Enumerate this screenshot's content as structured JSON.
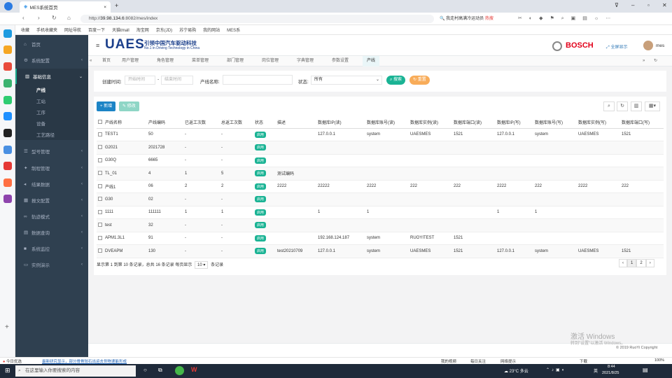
{
  "browser": {
    "tab_title": "MES系统首页",
    "url_prefix": "http://",
    "url_host": "39.98.134.6",
    "url_rest": ":8082/mes/index",
    "search_hint": "我走村高满冷运动员",
    "hot_label": "热搜",
    "bookmarks": [
      "收藏",
      "手机收藏夹",
      "网址导航",
      "百度一下",
      "天猫tmall",
      "淘宝网",
      "京东(JD)",
      "苏宁易购",
      "我的网站",
      "MES系"
    ]
  },
  "header": {
    "brand": "UAES",
    "brand_cn": "引领中国汽车驱动科技",
    "brand_en": "No.1 in Driving Technology in China",
    "partner": "BOSCH",
    "fullscreen": "全屏显示",
    "user": "mes"
  },
  "sidebar": {
    "home": "首页",
    "items": [
      {
        "label": "系统配置"
      },
      {
        "label": "基础信息"
      },
      {
        "label": "型号管理"
      },
      {
        "label": "制程管理"
      },
      {
        "label": "结果数据"
      },
      {
        "label": "报文配置"
      },
      {
        "label": "轨迹模式"
      },
      {
        "label": "数据查询"
      },
      {
        "label": "系统监控"
      },
      {
        "label": "实例演示"
      }
    ],
    "sub_items": [
      "产线",
      "工站",
      "工序",
      "设备",
      "工艺路径"
    ]
  },
  "page_tabs": [
    "首页",
    "用户管理",
    "角色管理",
    "菜单管理",
    "部门管理",
    "岗位管理",
    "字典管理",
    "参数设置",
    "产线"
  ],
  "search": {
    "created_label": "创建时间:",
    "start_placeholder": "开始时间",
    "end_placeholder": "结束时间",
    "line_name_label": "产线名称:",
    "status_label": "状态:",
    "status_value": "所有",
    "search_btn": "搜索",
    "reset_btn": "重置"
  },
  "toolbar": {
    "add_btn": "新增",
    "edit_btn": "修改"
  },
  "table": {
    "headers": [
      "产线名称",
      "产线编码",
      "已返工次数",
      "总返工次数",
      "状态",
      "描述",
      "数据库IP(读)",
      "数据库账号(读)",
      "数据库实例(读)",
      "数据库端口(读)",
      "数据库IP(写)",
      "数据库账号(写)",
      "数据库实例(写)",
      "数据库端口(写)"
    ],
    "rows": [
      [
        "TEST1",
        "50",
        "-",
        "-",
        "启用",
        "",
        "127.0.0.1",
        "system",
        "UAESMES",
        "1521",
        "127.0.0.1",
        "system",
        "UAESMES",
        "1521"
      ],
      [
        "G2021",
        "2021728",
        "-",
        "-",
        "启用",
        "",
        "",
        "",
        "",
        "",
        "",
        "",
        "",
        ""
      ],
      [
        "G30Q",
        "6665",
        "-",
        "-",
        "启用",
        "",
        "",
        "",
        "",
        "",
        "",
        "",
        "",
        ""
      ],
      [
        "TL_01",
        "4",
        "1",
        "5",
        "启用",
        "测试编码",
        "",
        "",
        "",
        "",
        "",
        "",
        "",
        ""
      ],
      [
        "产线1",
        "06",
        "2",
        "2",
        "启用",
        "2222",
        "22222",
        "2222",
        "222",
        "222",
        "2222",
        "222",
        "2222",
        "222"
      ],
      [
        "G30",
        "02",
        "-",
        "-",
        "启用",
        "",
        "",
        "",
        "",
        "",
        "",
        "",
        "",
        ""
      ],
      [
        "1111",
        "111111",
        "1",
        "1",
        "启用",
        "",
        "1",
        "1",
        "",
        "",
        "1",
        "1",
        "",
        ""
      ],
      [
        "test",
        "32",
        "-",
        "-",
        "启用",
        "",
        "",
        "",
        "",
        "",
        "",
        "",
        "",
        ""
      ],
      [
        "APM1.3L1",
        "91",
        "-",
        "-",
        "启用",
        "",
        "192.168.124.187",
        "system",
        "RUOYITEST",
        "1521",
        "",
        "",
        "",
        ""
      ],
      [
        "DVEAPM",
        "130",
        "-",
        "-",
        "启用",
        "test20210709",
        "127.0.0.1",
        "system",
        "UAESMES",
        "1521",
        "127.0.0.1",
        "system",
        "UAESMES",
        "1521"
      ]
    ]
  },
  "pagination": {
    "summary": "显示第 1 到第 10 条记录，总共 16 条记录 每页显示",
    "page_size": "10",
    "suffix": "条记录",
    "pages": [
      "‹",
      "1",
      "2",
      "›"
    ]
  },
  "footer": {
    "copyright": "© 2019 RuoYi Copyright",
    "watermark1": "激活 Windows",
    "watermark2": "转到\"设置\"以激活 Windows。"
  },
  "statusbar": {
    "left": "今日优选",
    "news": "最新研究显示，部分脊骨较石出运去世物速能形成",
    "right": [
      "我的视频",
      "每日关注",
      "网络提示",
      "下载",
      "100%"
    ]
  },
  "taskbar": {
    "search": "在这里输入你要搜索的内容",
    "weather": "23°C 多云",
    "lang": "英",
    "time": "8:44",
    "date": "2021/8/25"
  }
}
